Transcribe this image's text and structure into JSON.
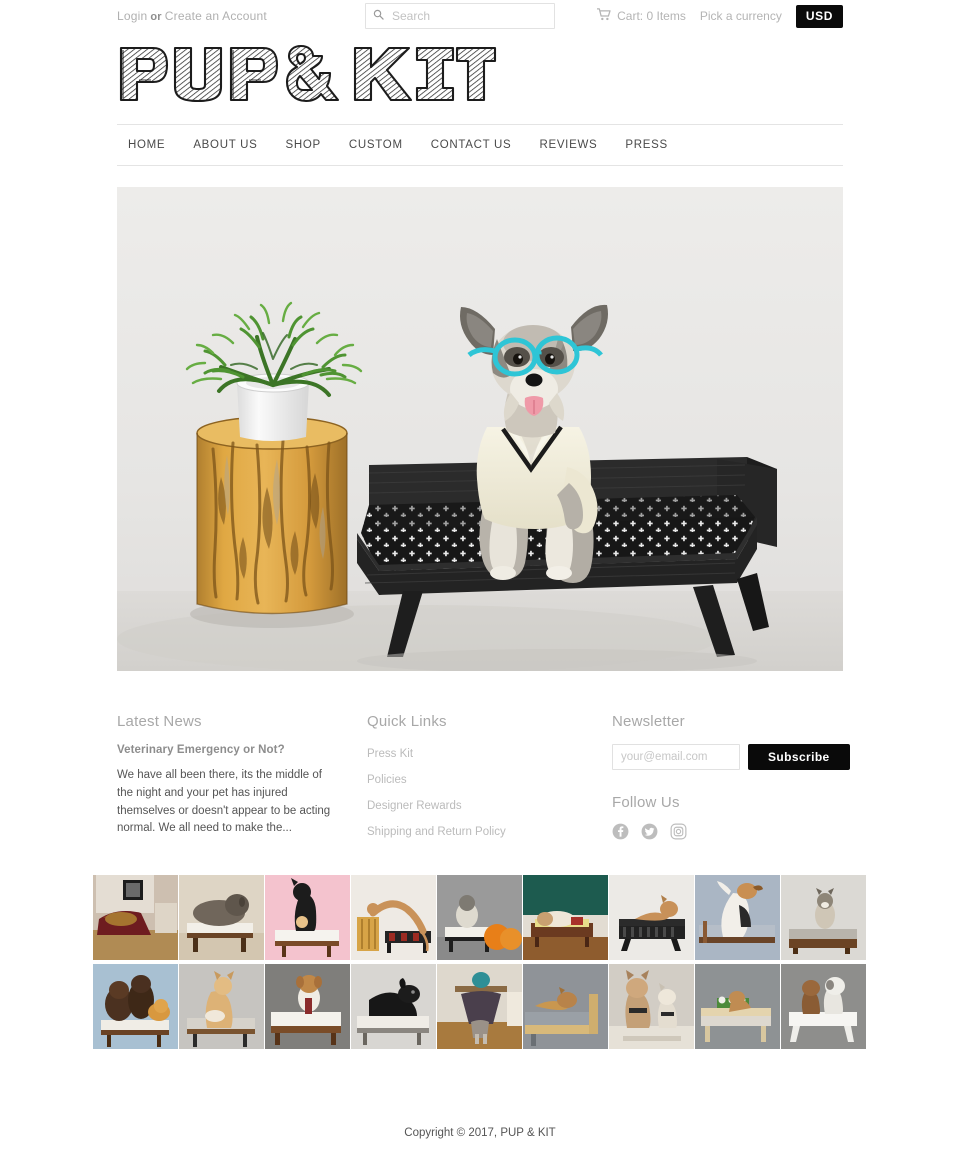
{
  "topbar": {
    "login_label": "Login",
    "or_label": "or",
    "create_account_label": "Create an Account",
    "search_placeholder": "Search",
    "search_value": "",
    "cart_label": "Cart: 0 Items",
    "currency_prompt": "Pick a currency",
    "currency_value": "USD"
  },
  "brand": {
    "logo_text": "PUP & KIT",
    "logo_style": "hand-drawn-hatched-slab-serif"
  },
  "nav": {
    "items": [
      {
        "label": "HOME"
      },
      {
        "label": "ABOUT US"
      },
      {
        "label": "SHOP"
      },
      {
        "label": "CUSTOM"
      },
      {
        "label": "CONTACT US"
      },
      {
        "label": "REVIEWS"
      },
      {
        "label": "PRESS"
      }
    ]
  },
  "hero": {
    "alt": "Schnauzer dog wearing teal eyeglasses and a cream v-neck sweater sitting on a black modern dog bed with white cross-patterned cushion, beside a natural wood log stool holding a white vase with green plant"
  },
  "footer": {
    "news": {
      "heading": "Latest News",
      "post_title": "Veterinary Emergency or Not?",
      "post_excerpt": "We have all been there, its the middle of the night and your pet has injured themselves or doesn't appear to be acting normal. We all need to make the..."
    },
    "quick_links": {
      "heading": "Quick Links",
      "items": [
        {
          "label": "Press Kit"
        },
        {
          "label": "Policies"
        },
        {
          "label": "Designer Rewards"
        },
        {
          "label": "Shipping and Return Policy"
        }
      ]
    },
    "newsletter": {
      "heading": "Newsletter",
      "email_placeholder": "your@email.com",
      "email_value": "",
      "subscribe_label": "Subscribe"
    },
    "follow": {
      "heading": "Follow Us",
      "items": [
        {
          "name": "facebook-icon"
        },
        {
          "name": "twitter-icon"
        },
        {
          "name": "instagram-icon"
        }
      ]
    }
  },
  "gallery": {
    "items": [
      {
        "alt": "Golden dog resting on dark red plaid blanket on sofa in a room with framed art and wood floor"
      },
      {
        "alt": "Shaggy grey doodle dog lying on a white cushioned walnut dog bed"
      },
      {
        "alt": "Black dog in bow tie sitting on white cushioned bed against a pink background"
      },
      {
        "alt": "Tan italian greyhound stepping from a wood log stool onto a red patterned dog bed"
      },
      {
        "alt": "Small schnauzer on a white dog bed next to two orange pumpkins on grey background"
      },
      {
        "alt": "Dog lying on a floral cushioned dog bed in front of a dark green wall"
      },
      {
        "alt": "Tan greyhound lying on a black slatted modern dog bed"
      },
      {
        "alt": "Beagle in a tuxedo outfit raising a paw on a grey cushioned bed"
      },
      {
        "alt": "Small scruffy dog sitting on a walnut platform dog bed, grey background"
      },
      {
        "alt": "Two brown newfoundland puppies and a pomeranian on a white cushioned bed, blue background"
      },
      {
        "alt": "Tan shepherd mix sitting on a grey cushioned mid-century dog bed"
      },
      {
        "alt": "Toy poodle wearing a shirt and tie on a white cushioned walnut bed"
      },
      {
        "alt": "Black labrador lying on a white cushioned dog bed"
      },
      {
        "alt": "Grey cat climbing into a covered pet bed beneath a side table with a teal vase"
      },
      {
        "alt": "Tan pug mix lying on a grey cushioned light wood dog bed"
      },
      {
        "alt": "Two french bulldogs in harnesses sitting on a white floor, grey background"
      },
      {
        "alt": "Brown dog on a light wood dog bed with small green plants behind"
      },
      {
        "alt": "Two small dogs in sweaters sitting on a white modern dog bed"
      }
    ]
  },
  "copyright": {
    "text": "Copyright © 2017, PUP & KIT"
  },
  "colors": {
    "accent_black": "#0a0a0a",
    "muted_text": "#b4b4b4",
    "body_text": "#555555",
    "rule": "#e4e4e4"
  }
}
